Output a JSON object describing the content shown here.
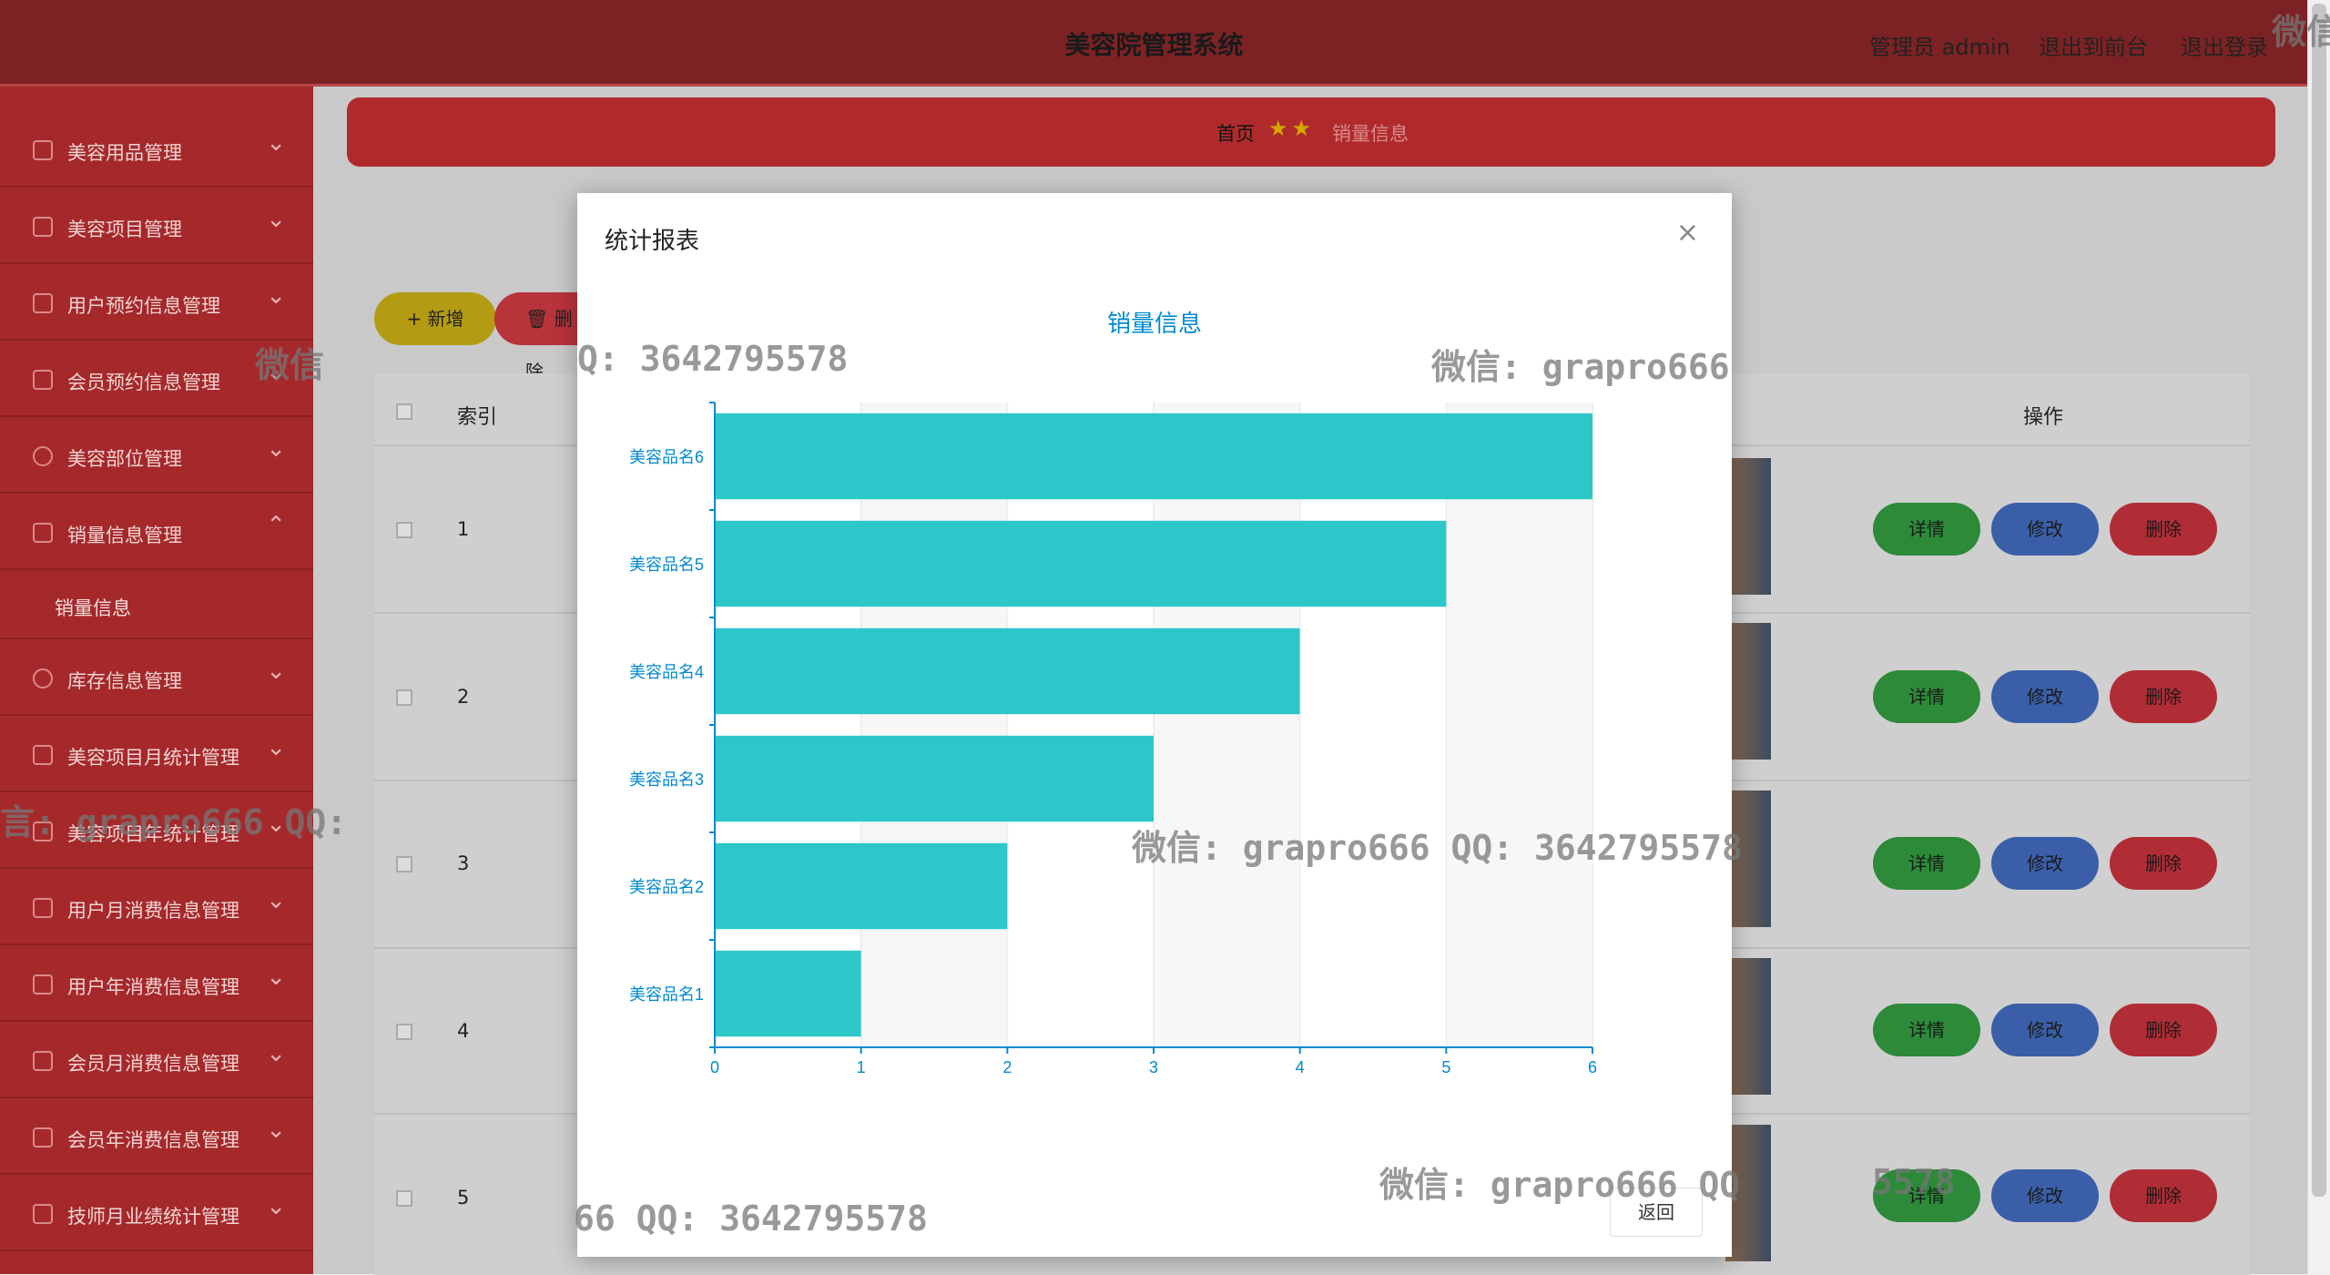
{
  "header": {
    "title": "美容院管理系统",
    "admin": "管理员 admin",
    "front": "退出到前台",
    "logout": "退出登录"
  },
  "sidebar": {
    "items": [
      {
        "label": "美容用品管理"
      },
      {
        "label": "美容项目管理"
      },
      {
        "label": "用户预约信息管理"
      },
      {
        "label": "会员预约信息管理"
      },
      {
        "label": "美容部位管理"
      },
      {
        "label": "销量信息管理"
      },
      {
        "label": "库存信息管理"
      },
      {
        "label": "美容项目月统计管理"
      },
      {
        "label": "美容项目年统计管理"
      },
      {
        "label": "用户月消费信息管理"
      },
      {
        "label": "用户年消费信息管理"
      },
      {
        "label": "会员月消费信息管理"
      },
      {
        "label": "会员年消费信息管理"
      },
      {
        "label": "技师月业绩统计管理"
      }
    ],
    "sub_item": "销量信息"
  },
  "breadcrumb": {
    "home": "首页",
    "current": "销量信息"
  },
  "toolbar": {
    "add": "+ 新增",
    "delete": "删除"
  },
  "table": {
    "col_index": "索引",
    "col_action": "操作",
    "rows": [
      {
        "index": "1"
      },
      {
        "index": "2"
      },
      {
        "index": "3"
      },
      {
        "index": "4"
      },
      {
        "index": "5"
      }
    ],
    "detail": "详情",
    "edit": "修改",
    "remove": "删除"
  },
  "modal": {
    "title": "统计报表",
    "close": "×",
    "back": "返回"
  },
  "watermarks": {
    "w1": "Q: 3642795578",
    "w2": "微信: grapro666",
    "w3": "微信: grapro666 QQ: 3642795578",
    "w4": "微信: grapro666 QQ",
    "w5": "66 QQ: 3642795578",
    "w6": "言: grapro666 QQ:",
    "w7": "微信",
    "w8": "微信",
    "w9": "5578"
  },
  "colors": {
    "bar": "#2ec7c9",
    "axis": "#008acd",
    "header": "#7d2224",
    "sidebar": "#a5292b"
  },
  "chart_data": {
    "type": "bar",
    "orientation": "horizontal",
    "title": "销量信息",
    "categories": [
      "美容品名1",
      "美容品名2",
      "美容品名3",
      "美容品名4",
      "美容品名5",
      "美容品名6"
    ],
    "values": [
      1,
      2,
      3,
      4,
      5,
      6
    ],
    "xlim": [
      0,
      6
    ],
    "xticks": [
      0,
      1,
      2,
      3,
      4,
      5,
      6
    ],
    "grid": true
  }
}
